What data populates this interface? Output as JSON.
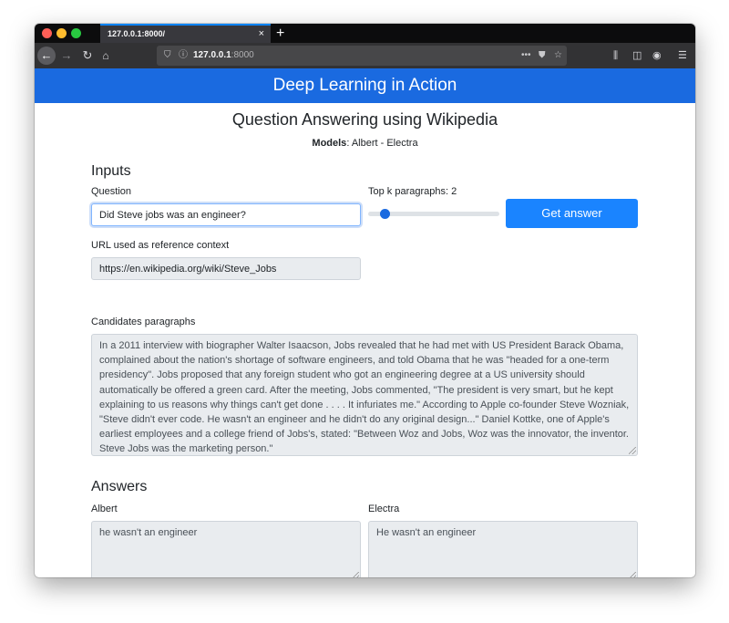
{
  "browser": {
    "tab_title": "127.0.0.1:8000/",
    "tab_close_glyph": "×",
    "new_tab_glyph": "+",
    "url_host": "127.0.0.1",
    "url_port": ":8000",
    "traffic_colors": [
      "#ff5f57",
      "#febc2e",
      "#28c840"
    ]
  },
  "app": {
    "header_title": "Deep Learning in Action",
    "page_title": "Question Answering using Wikipedia",
    "models_label": "Models",
    "models_value": ": Albert - Electra"
  },
  "inputs": {
    "section_title": "Inputs",
    "question_label": "Question",
    "question_value": "Did Steve jobs was an engineer?",
    "topk_label": "Top k paragraphs: 2",
    "topk_value": 2,
    "submit_label": "Get answer",
    "url_label": "URL used as reference context",
    "url_value": "https://en.wikipedia.org/wiki/Steve_Jobs",
    "candidates_label": "Candidates paragraphs",
    "candidates_text": "In a 2011 interview with biographer Walter Isaacson, Jobs revealed that he had met with US President Barack Obama, complained about the nation's shortage of software engineers, and told Obama that he was \"headed for a one-term presidency\". Jobs proposed that any foreign student who got an engineering degree at a US university should automatically be offered a green card. After the meeting, Jobs commented, \"The president is very smart, but he kept explaining to us reasons why things can't get done . . . . It infuriates me.\" According to Apple co-founder Steve Wozniak, \"Steve didn't ever code. He wasn't an engineer and he didn't do any original design...\" Daniel Kottke, one of Apple's earliest employees and a college friend of Jobs's, stated: \"Between Woz and Jobs, Woz was the innovator, the inventor. Steve Jobs was the marketing person.\""
  },
  "answers": {
    "section_title": "Answers",
    "albert_label": "Albert",
    "albert_value": "he wasn't an engineer",
    "electra_label": "Electra",
    "electra_value": "He wasn't an engineer"
  },
  "colors": {
    "header_bg": "#1a6ae0",
    "button_bg": "#1a84ff",
    "readonly_bg": "#e9ecef"
  }
}
